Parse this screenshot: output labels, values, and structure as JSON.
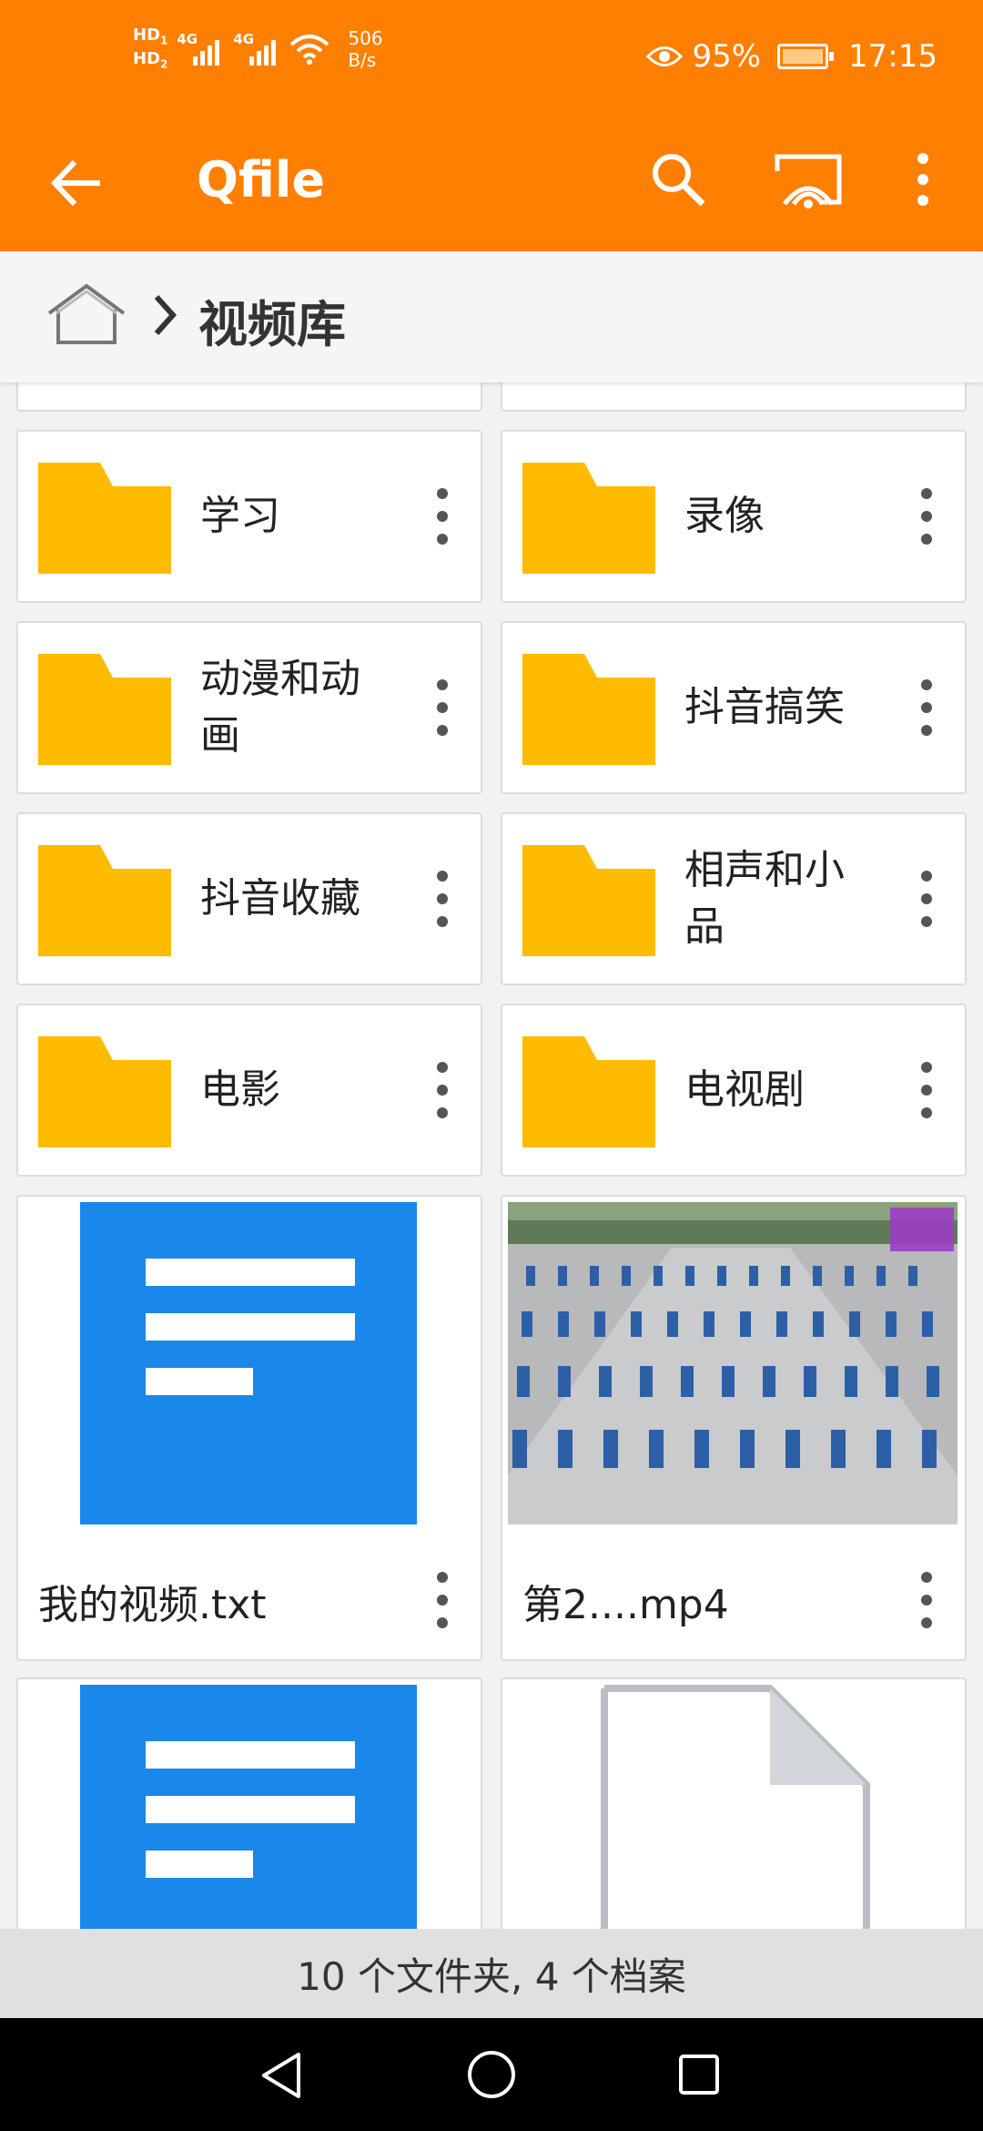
{
  "status_bar": {
    "hd1": "HD",
    "hd1_sub": "1",
    "hd2": "HD",
    "hd2_sub": "2",
    "signal1": "4G",
    "signal2": "4G",
    "net_speed_value": "506",
    "net_speed_unit": "B/s",
    "battery": "95%",
    "time": "17:15"
  },
  "app_bar": {
    "title": "Qfile",
    "back_icon": "arrow-left-icon",
    "search_icon": "search-icon",
    "cast_icon": "cast-icon",
    "more_icon": "more-vert-icon"
  },
  "breadcrumb": {
    "home_icon": "home-icon",
    "separator_icon": "chevron-right-icon",
    "current": "视频库"
  },
  "folders": [
    {
      "name": "学习"
    },
    {
      "name": "录像"
    },
    {
      "name": "动漫和动画"
    },
    {
      "name": "抖音搞笑"
    },
    {
      "name": "抖音收藏"
    },
    {
      "name": "相声和小品"
    },
    {
      "name": "电影"
    },
    {
      "name": "电视剧"
    }
  ],
  "files": [
    {
      "name": "我的视频.txt",
      "type": "text-document"
    },
    {
      "name": "第2....mp4",
      "type": "video"
    },
    {
      "name": "",
      "type": "text-document"
    },
    {
      "name": "",
      "type": "blank-file"
    }
  ],
  "summary": "10 个文件夹, 4 个档案",
  "nav": {
    "back_icon": "triangle-back-icon",
    "home_icon": "circle-home-icon",
    "recent_icon": "square-recents-icon"
  },
  "colors": {
    "accent": "#ff7f00",
    "folder": "#ffbb00",
    "doc_blue": "#1a87ea"
  }
}
